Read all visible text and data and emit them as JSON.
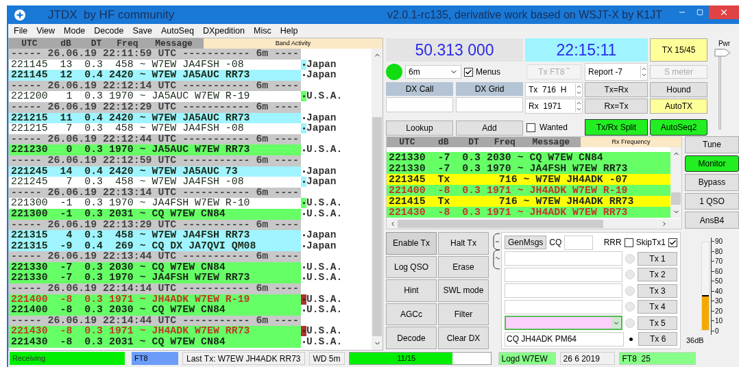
{
  "window": {
    "title": "JTDX  by HF community",
    "version": "v2.0.1-rc135, derivative work based on WSJT-X by K1JT"
  },
  "menu": [
    "File",
    "View",
    "Mode",
    "Decode",
    "Save",
    "AutoSeq",
    "DXpedition",
    "Misc",
    "Help"
  ],
  "band_activity": {
    "title": "Band Activity",
    "columns": [
      "UTC",
      "dB",
      "DT",
      "Freq",
      "Message"
    ],
    "rows": [
      {
        "kind": "separator",
        "text": "----- 26.06.19 22:11:59 UTC ----------- 6m ----"
      },
      {
        "kind": "decode",
        "text": "221145  13  0.3  458 ~ W7EW JA4FSH -08",
        "color": "#ffffff",
        "alert": false,
        "bold": false,
        "country": "Japan",
        "marker": {
          "color": "#9ff4ff"
        }
      },
      {
        "kind": "decode",
        "text": "221145  12  0.4 2420 ~ W7EW JA5AUC RR73",
        "color": "#9ff4ff",
        "alert": false,
        "bold": true,
        "country": "Japan"
      },
      {
        "kind": "separator",
        "text": "----- 26.06.19 22:12:14 UTC ----------- 6m ----"
      },
      {
        "kind": "decode",
        "text": "221200   1  0.3 1970 ~ JA5AUC W7EW R-19",
        "color": "#ffffff",
        "alert": false,
        "bold": false,
        "country": "U.S.A.",
        "marker": {
          "color": "#66ff66"
        }
      },
      {
        "kind": "separator",
        "text": "----- 26.06.19 22:12:29 UTC ----------- 6m ----"
      },
      {
        "kind": "decode",
        "text": "221215  11  0.4 2420 ~ W7EW JA5AUC RR73",
        "color": "#9ff4ff",
        "alert": false,
        "bold": true,
        "country": "Japan"
      },
      {
        "kind": "decode",
        "text": "221215   7  0.3  458 ~ W7EW JA4FSH -08",
        "color": "#ffffff",
        "alert": false,
        "bold": false,
        "country": "Japan",
        "marker": {
          "color": "#9ff4ff"
        }
      },
      {
        "kind": "separator",
        "text": "----- 26.06.19 22:12:44 UTC ----------- 6m ----"
      },
      {
        "kind": "decode",
        "text": "221230   0  0.3 1970 ~ JA5AUC W7EW RR73",
        "color": "#66ff66",
        "alert": false,
        "bold": true,
        "country": "U.S.A."
      },
      {
        "kind": "separator",
        "text": "----- 26.06.19 22:12:59 UTC ----------- 6m ----"
      },
      {
        "kind": "decode",
        "text": "221245  14  0.4 2420 ~ W7EW JA5AUC 73",
        "color": "#9ff4ff",
        "alert": false,
        "bold": true,
        "country": "Japan"
      },
      {
        "kind": "decode",
        "text": "221245   7  0.3  458 ~ W7EW JA4FSH -08",
        "color": "#ffffff",
        "alert": false,
        "bold": false,
        "country": "Japan",
        "marker": {
          "color": "#9ff4ff"
        }
      },
      {
        "kind": "separator",
        "text": "----- 26.06.19 22:13:14 UTC ----------- 6m ----"
      },
      {
        "kind": "decode",
        "text": "221300  -1  0.3 1970 ~ JA4FSH W7EW R-10",
        "color": "#ffffff",
        "alert": false,
        "bold": false,
        "country": "U.S.A.",
        "marker": {
          "color": "#66ff66"
        }
      },
      {
        "kind": "decode",
        "text": "221300  -1  0.3 2031 ~ CQ W7EW CN84",
        "color": "#66ff66",
        "alert": false,
        "bold": true,
        "country": "U.S.A."
      },
      {
        "kind": "separator",
        "text": "----- 26.06.19 22:13:29 UTC ----------- 6m ----"
      },
      {
        "kind": "decode",
        "text": "221315   4  0.3  458 ~ W7EW JA4FSH RR73",
        "color": "#9ff4ff",
        "alert": false,
        "bold": true,
        "country": "Japan"
      },
      {
        "kind": "decode",
        "text": "221315  -9  0.4  269 ~ CQ DX JA7QVI QM08",
        "color": "#9ff4ff",
        "alert": false,
        "bold": true,
        "country": "Japan"
      },
      {
        "kind": "separator",
        "text": "----- 26.06.19 22:13:44 UTC ----------- 6m ----"
      },
      {
        "kind": "decode",
        "text": "221330  -7  0.3 2030 ~ CQ W7EW CN84",
        "color": "#66ff66",
        "alert": false,
        "bold": true,
        "country": "U.S.A."
      },
      {
        "kind": "decode",
        "text": "221330  -7  0.3 1970 ~ JA4FSH W7EW RR73",
        "color": "#66ff66",
        "alert": false,
        "bold": true,
        "country": "U.S.A."
      },
      {
        "kind": "separator",
        "text": "----- 26.06.19 22:14:14 UTC ----------- 6m ----"
      },
      {
        "kind": "decode",
        "text": "221400  -8  0.3 1971 ~ JH4ADK W7EW R-19",
        "color": "#66ff66",
        "alert": true,
        "bold": true,
        "country": "U.S.A.",
        "marker": {
          "color": "#b03030"
        }
      },
      {
        "kind": "decode",
        "text": "221400  -8  0.3 2030 ~ CQ W7EW CN84",
        "color": "#66ff66",
        "alert": false,
        "bold": true,
        "country": "U.S.A."
      },
      {
        "kind": "separator",
        "text": "----- 26.06.19 22:14:44 UTC ----------- 6m ----"
      },
      {
        "kind": "decode",
        "text": "221430  -8  0.3 1971 ~ JH4ADK W7EW RR73",
        "color": "#66ff66",
        "alert": true,
        "bold": true,
        "country": "U.S.A.",
        "marker": {
          "color": "#b03030"
        }
      },
      {
        "kind": "decode",
        "text": "221430  -8  0.3 2031 ~ CQ W7EW CN84",
        "color": "#66ff66",
        "alert": false,
        "bold": true,
        "country": "U.S.A."
      }
    ]
  },
  "frequency": "50.313 000",
  "clock": "22:15:11",
  "tx_period": "TX 15/45",
  "power": {
    "label": "Pwr",
    "level": 1
  },
  "band": "6m",
  "menus": {
    "label": "Menus",
    "checked": true
  },
  "tx_mode": {
    "label": "Tx FT8 ˜",
    "disabled": true
  },
  "report": {
    "label": "Report",
    "value": "-7"
  },
  "s_meter": {
    "label": "S meter",
    "disabled": true
  },
  "dx_call": {
    "label": "DX Call"
  },
  "dx_grid": {
    "label": "DX Grid"
  },
  "tx_freq": {
    "label": "Tx",
    "value": "716",
    "suffix": "H"
  },
  "rx_freq": {
    "label": "Rx",
    "value": "1971"
  },
  "buttons_grid": [
    {
      "label": "Tx=Rx",
      "on": false
    },
    {
      "label": "Hound",
      "on": false
    },
    {
      "label": "Rx=Tx",
      "on": false
    },
    {
      "label": "AutoTX",
      "on": true
    }
  ],
  "lookup": "Lookup",
  "add": "Add",
  "wanted": {
    "label": "Wanted",
    "checked": false
  },
  "split": {
    "label": "Tx/Rx Split",
    "on": true
  },
  "autoseq": {
    "label": "AutoSeq2",
    "on": true
  },
  "rx_frequency": {
    "title": "Rx Frequency",
    "columns": [
      "UTC",
      "dB",
      "DT",
      "Freq",
      "Message"
    ],
    "rows": [
      {
        "text": "221330  -7  0.3 2030 ~ CQ W7EW CN84",
        "kind": "rx",
        "alert": false
      },
      {
        "text": "221330  -7  0.3 1970 ~ JA4FSH W7EW RR73",
        "kind": "rx",
        "alert": false
      },
      {
        "text": "221345  Tx        716 ~ W7EW JH4ADK -07",
        "kind": "tx",
        "alert": false
      },
      {
        "text": "221400  -8  0.3 1971 ~ JH4ADK W7EW R-19",
        "kind": "rx",
        "alert": true
      },
      {
        "text": "221415  Tx        716 ~ W7EW JH4ADK RR73",
        "kind": "tx",
        "alert": false
      },
      {
        "text": "221430  -8  0.3 1971 ~ JH4ADK W7EW RR73",
        "kind": "rx",
        "alert": true
      }
    ]
  },
  "side_buttons": [
    {
      "label": "Tune",
      "on": false
    },
    {
      "label": "Monitor",
      "on": true
    },
    {
      "label": "Bypass",
      "on": false
    },
    {
      "label": "1 QSO",
      "on": false
    },
    {
      "label": "AnsB4",
      "on": false
    }
  ],
  "control_buttons": [
    {
      "label": "Enable Tx",
      "on": true
    },
    {
      "label": "Halt Tx",
      "on": false
    },
    {
      "label": "Log QSO",
      "on": false
    },
    {
      "label": "Erase",
      "on": false
    },
    {
      "label": "Hint",
      "on": false
    },
    {
      "label": "SWL mode",
      "on": false
    },
    {
      "label": "AGCc",
      "on": false
    },
    {
      "label": "Filter",
      "on": false
    },
    {
      "label": "Decode",
      "on": false
    },
    {
      "label": "Clear DX",
      "on": false
    }
  ],
  "genmsgs": {
    "button": "GenMsgs",
    "cq_label": "CQ",
    "rrr": {
      "label": "RRR",
      "checked": false
    },
    "skip_tx1": {
      "label": "SkipTx1",
      "checked": true
    }
  },
  "messages": [
    {
      "kind": "field",
      "selected": false,
      "tx_button": "Tx 1"
    },
    {
      "kind": "field",
      "selected": false,
      "tx_button": "Tx 2"
    },
    {
      "kind": "field",
      "selected": false,
      "tx_button": "Tx 3"
    },
    {
      "kind": "field",
      "selected": false,
      "tx_button": "Tx 4"
    },
    {
      "kind": "combo",
      "selected": false,
      "tx_button": "Tx 5"
    },
    {
      "kind": "field",
      "selected": true,
      "tx_button": "Tx 6",
      "value": "CQ JH4ADK PM64"
    }
  ],
  "signal_meter": {
    "scale": [
      "90",
      "80",
      "70",
      "60",
      "50",
      "40",
      "30",
      "20",
      "10",
      "0"
    ],
    "level": 0.4,
    "reading": "36dB"
  },
  "status_bar": {
    "state": "Receiving",
    "mode": "FT8",
    "last_tx": "Last Tx: W7EW JH4ADK RR73",
    "watchdog": "WD 5m",
    "progress": {
      "text": "11/15",
      "level": 0.733
    },
    "logged": "Logd W7EW",
    "date": "26 6 2019",
    "mode_count": "FT8  25"
  }
}
